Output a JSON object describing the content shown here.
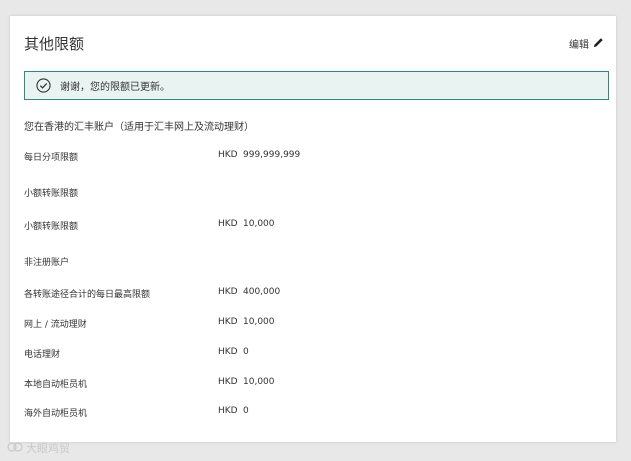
{
  "header": {
    "title": "其他限额",
    "edit_label": "编辑"
  },
  "banner": {
    "message": "谢谢，您的限额已更新。"
  },
  "account_heading": "您在香港的汇丰账户（适用于汇丰网上及流动理财）",
  "rows": [
    {
      "label": "每日分项限额",
      "currency": "HKD",
      "value": "999,999,999"
    },
    {
      "label": "小额转账限额",
      "currency": "HKD",
      "value": "10,000"
    },
    {
      "label": "各转账途径合计的每日最高限额",
      "currency": "HKD",
      "value": "400,000"
    },
    {
      "label": "网上 / 流动理财",
      "currency": "HKD",
      "value": "10,000"
    },
    {
      "label": "电话理财",
      "currency": "HKD",
      "value": "0"
    },
    {
      "label": "本地自动柜员机",
      "currency": "HKD",
      "value": "10,000"
    },
    {
      "label": "海外自动柜员机",
      "currency": "HKD",
      "value": "0"
    }
  ],
  "sections": {
    "small_transfer": "小额转账限额",
    "unregistered": "非注册账户"
  },
  "watermark": "大眼鸡贸",
  "colors": {
    "banner_border": "#2e8b7a",
    "banner_bg": "#e9f4f2"
  }
}
